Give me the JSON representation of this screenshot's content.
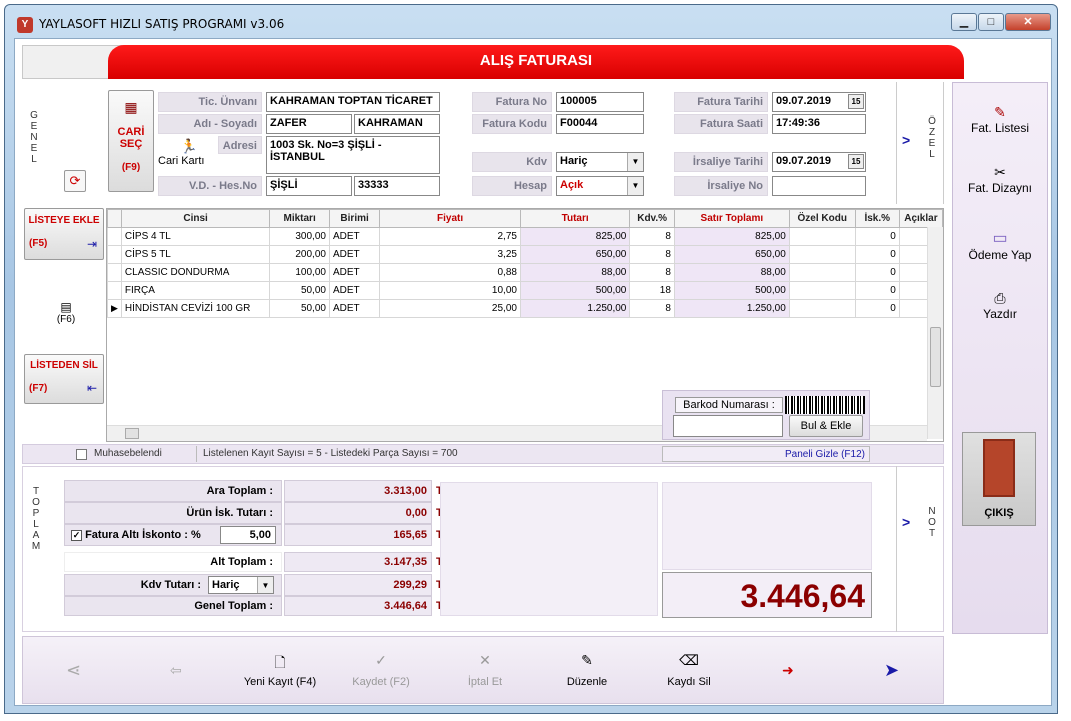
{
  "window": {
    "title": "YAYLASOFT HIZLI SATIŞ PROGRAMI v3.06",
    "app_icon": "Y",
    "minimize": "▁",
    "maximize": "□",
    "close": "✕"
  },
  "banner": {
    "title": "ALIŞ FATURASI"
  },
  "genel_label": "GENEL",
  "ozel_label": "ÖZEL",
  "toplam_label": "TOPLAM",
  "not_label": "NOT",
  "arrow": ">",
  "cari": {
    "sec_label_1": "CARİ",
    "sec_label_2": "SEÇ",
    "sec_key": "(F9)",
    "cari_karti": "Cari Kartı",
    "tic_unvani_label": "Tic. Ünvanı",
    "tic_unvani": "KAHRAMAN TOPTAN TİCARET",
    "adi_soyadi_label": "Adı - Soyadı",
    "adi": "ZAFER",
    "soyadi": "KAHRAMAN",
    "adresi_label": "Adresi",
    "adresi": "1003 Sk. No=3 ŞİŞLİ - İSTANBUL",
    "vd_label": "V.D. - Hes.No",
    "vd": "ŞİŞLİ",
    "hesno": "33333"
  },
  "fatura": {
    "no_label": "Fatura No",
    "no": "100005",
    "kodu_label": "Fatura Kodu",
    "kodu": "F00044",
    "kdv_label": "Kdv",
    "kdv": "Hariç",
    "hesap_label": "Hesap",
    "hesap": "Açık",
    "tarihi_label": "Fatura Tarihi",
    "tarihi": "09.07.2019",
    "saati_label": "Fatura Saati",
    "saati": "17:49:36",
    "irsaliye_tarihi_label": "İrsaliye Tarihi",
    "irsaliye_tarihi": "09.07.2019",
    "irsaliye_no_label": "İrsaliye No",
    "irsaliye_no": "",
    "cal_icon": "15"
  },
  "left_buttons": {
    "listeye_ekle": "LİSTEYE EKLE",
    "listeye_ekle_key": "(F5)",
    "f6": "(F6)",
    "listeden_sil": "LİSTEDEN SİL",
    "listeden_sil_key": "(F7)"
  },
  "grid": {
    "columns": [
      "Cinsi",
      "Miktarı",
      "Birimi",
      "Fiyatı",
      "Tutarı",
      "Kdv.%",
      "Satır Toplamı",
      "Özel Kodu",
      "İsk.%",
      "Açıklar"
    ],
    "rows": [
      [
        "CİPS 4 TL",
        "300,00",
        "ADET",
        "2,75",
        "825,00",
        "8",
        "825,00",
        "",
        "0",
        ""
      ],
      [
        "CİPS 5 TL",
        "200,00",
        "ADET",
        "3,25",
        "650,00",
        "8",
        "650,00",
        "",
        "0",
        ""
      ],
      [
        "CLASSIC DONDURMA",
        "100,00",
        "ADET",
        "0,88",
        "88,00",
        "8",
        "88,00",
        "",
        "0",
        ""
      ],
      [
        "FIRÇA",
        "50,00",
        "ADET",
        "10,00",
        "500,00",
        "18",
        "500,00",
        "",
        "0",
        ""
      ],
      [
        "HİNDİSTAN CEVİZİ 100 GR",
        "50,00",
        "ADET",
        "25,00",
        "1.250,00",
        "8",
        "1.250,00",
        "",
        "0",
        ""
      ]
    ],
    "current_row_marker": "▶"
  },
  "barkod": {
    "label": "Barkod Numarası :",
    "value": "",
    "button": "Bul & Ekle"
  },
  "status": {
    "muhasebelendi": "Muhasebelendi",
    "summary": "Listelenen Kayıt Sayısı = 5  -  Listedeki Parça Sayısı = 700",
    "paneli_gizle": "Paneli Gizle (F12)"
  },
  "totals": {
    "ara_toplam_label": "Ara Toplam :",
    "ara_toplam": "3.313,00",
    "urun_isk_label": "Ürün İsk. Tutarı :",
    "urun_isk": "0,00",
    "fatura_alti_label": "Fatura Altı İskonto :",
    "fatura_alti_pct_sign": "%",
    "fatura_alti_pct": "5,00",
    "fatura_alti": "165,65",
    "alt_toplam_label": "Alt Toplam :",
    "alt_toplam": "3.147,35",
    "kdv_tutari_label": "Kdv Tutarı :",
    "kdv_mode": "Hariç",
    "kdv_tutari": "299,29",
    "genel_toplam_label": "Genel Toplam :",
    "genel_toplam": "3.446,64",
    "currency": "TL",
    "big_total": "3.446,64"
  },
  "sidebar": {
    "fat_listesi": "Fat. Listesi",
    "fat_dizayni": "Fat. Dizaynı",
    "odeme_yap": "Ödeme Yap",
    "yazdir": "Yazdır",
    "cikis": "ÇIKIŞ"
  },
  "bottom": {
    "yeni_kayit": "Yeni Kayıt (F4)",
    "kaydet": "Kaydet (F2)",
    "iptal_et": "İptal Et",
    "duzenle": "Düzenle",
    "kaydi_sil": "Kaydı Sil"
  },
  "colors": {
    "banner_red": "#e00000",
    "panel_lilac": "#f2edf7",
    "total_red": "#8b0000",
    "arrow_blue": "#1a1aa8"
  }
}
